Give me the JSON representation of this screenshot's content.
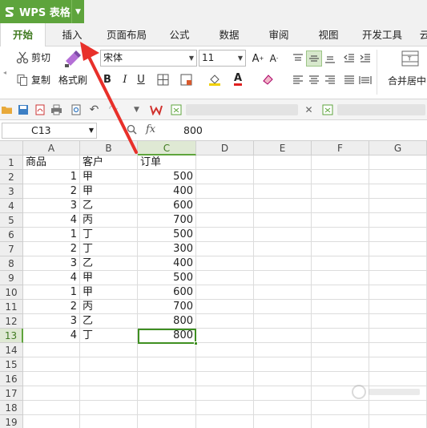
{
  "app": {
    "name": "WPS 表格"
  },
  "tabs": [
    {
      "label": "开始",
      "active": true
    },
    {
      "label": "插入"
    },
    {
      "label": "页面布局"
    },
    {
      "label": "公式"
    },
    {
      "label": "数据"
    },
    {
      "label": "审阅"
    },
    {
      "label": "视图"
    },
    {
      "label": "开发工具"
    },
    {
      "label": "云"
    }
  ],
  "ribbon": {
    "cut_label": "剪切",
    "copy_label": "复制",
    "format_painter_label": "格式刷",
    "font_name": "宋体",
    "font_size": "11",
    "merge_center_label": "合并居中"
  },
  "formula_bar": {
    "cell_ref": "C13",
    "fx_label": "fx",
    "value": "800"
  },
  "sheet": {
    "columns": [
      "A",
      "B",
      "C",
      "D",
      "E",
      "F",
      "G"
    ],
    "selected_column": "C",
    "selected_row": "13",
    "rows": [
      {
        "n": "1",
        "a": "商品",
        "b": "客户",
        "c": "订单"
      },
      {
        "n": "2",
        "a": "1",
        "b": "甲",
        "c": "500"
      },
      {
        "n": "3",
        "a": "2",
        "b": "甲",
        "c": "400"
      },
      {
        "n": "4",
        "a": "3",
        "b": "乙",
        "c": "600"
      },
      {
        "n": "5",
        "a": "4",
        "b": "丙",
        "c": "700"
      },
      {
        "n": "6",
        "a": "1",
        "b": "丁",
        "c": "500"
      },
      {
        "n": "7",
        "a": "2",
        "b": "丁",
        "c": "300"
      },
      {
        "n": "8",
        "a": "3",
        "b": "乙",
        "c": "400"
      },
      {
        "n": "9",
        "a": "4",
        "b": "甲",
        "c": "500"
      },
      {
        "n": "10",
        "a": "1",
        "b": "甲",
        "c": "600"
      },
      {
        "n": "11",
        "a": "2",
        "b": "丙",
        "c": "700"
      },
      {
        "n": "12",
        "a": "3",
        "b": "乙",
        "c": "800"
      },
      {
        "n": "13",
        "a": "4",
        "b": "丁",
        "c": "800"
      },
      {
        "n": "14",
        "a": "",
        "b": "",
        "c": ""
      },
      {
        "n": "15",
        "a": "",
        "b": "",
        "c": ""
      },
      {
        "n": "16",
        "a": "",
        "b": "",
        "c": ""
      },
      {
        "n": "17",
        "a": "",
        "b": "",
        "c": ""
      },
      {
        "n": "18",
        "a": "",
        "b": "",
        "c": ""
      },
      {
        "n": "19",
        "a": "",
        "b": "",
        "c": ""
      }
    ]
  },
  "colors": {
    "brand_green": "#5ea43c",
    "active_tab_text": "#3f7a20",
    "selection_border": "#3f8f22",
    "annotation_arrow": "#e8302a"
  }
}
